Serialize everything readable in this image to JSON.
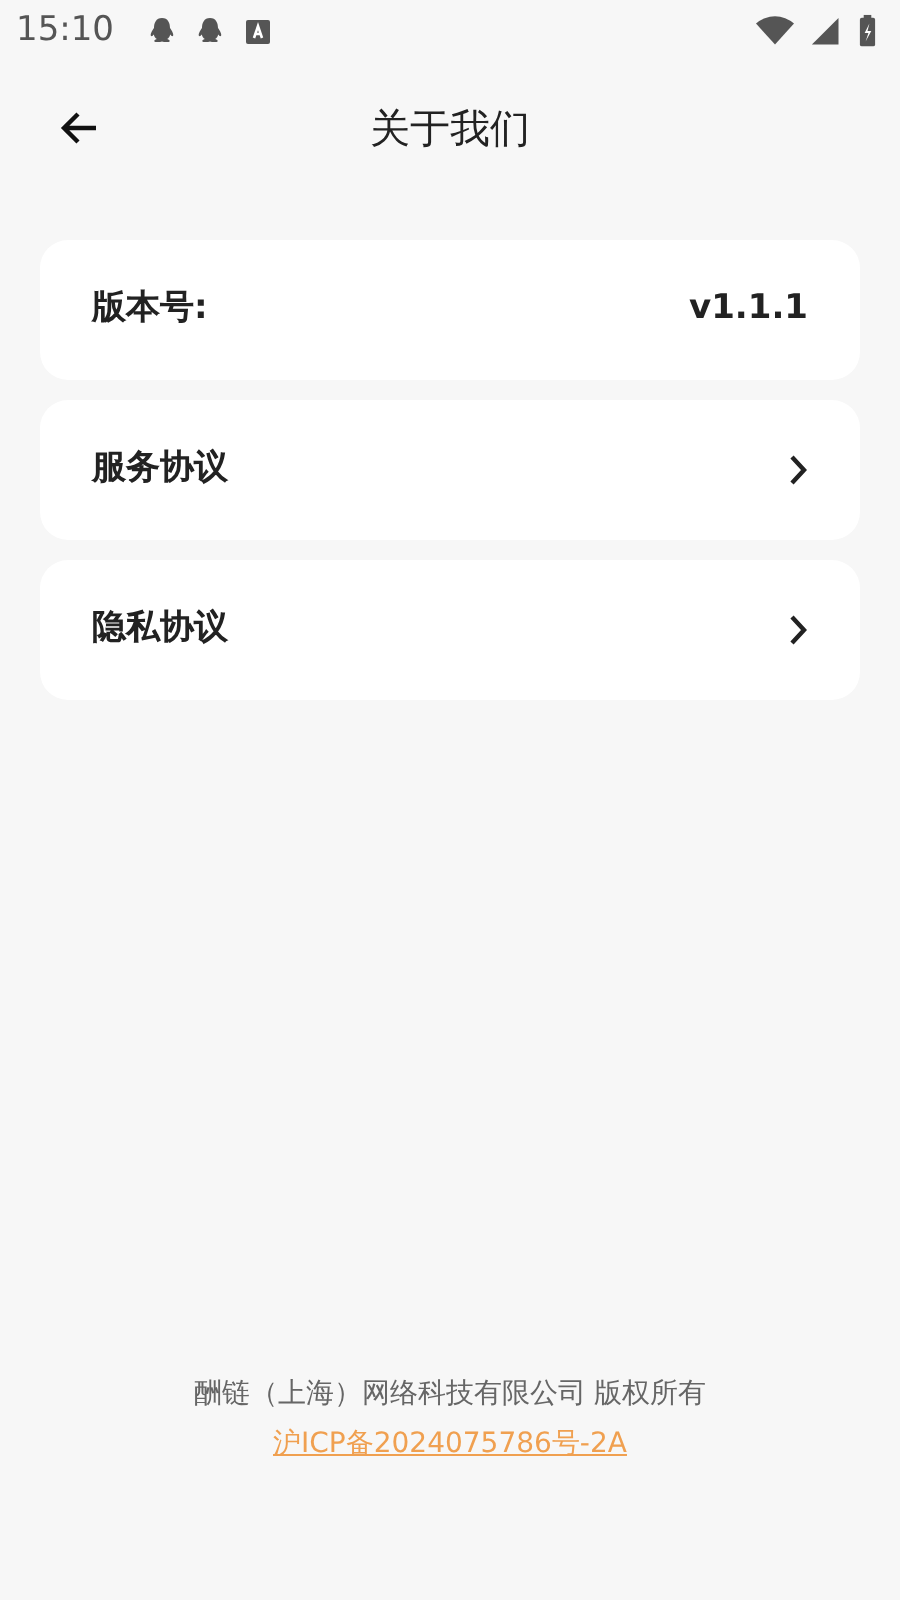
{
  "status_bar": {
    "time": "15:10"
  },
  "header": {
    "title": "关于我们"
  },
  "items": [
    {
      "kind": "value",
      "label": "版本号:",
      "value": "v1.1.1"
    },
    {
      "kind": "link",
      "label": "服务协议"
    },
    {
      "kind": "link",
      "label": "隐私协议"
    }
  ],
  "footer": {
    "copyright": "酬链（上海）网络科技有限公司 版权所有",
    "icp_link": "沪ICP备2024075786号-2A"
  }
}
